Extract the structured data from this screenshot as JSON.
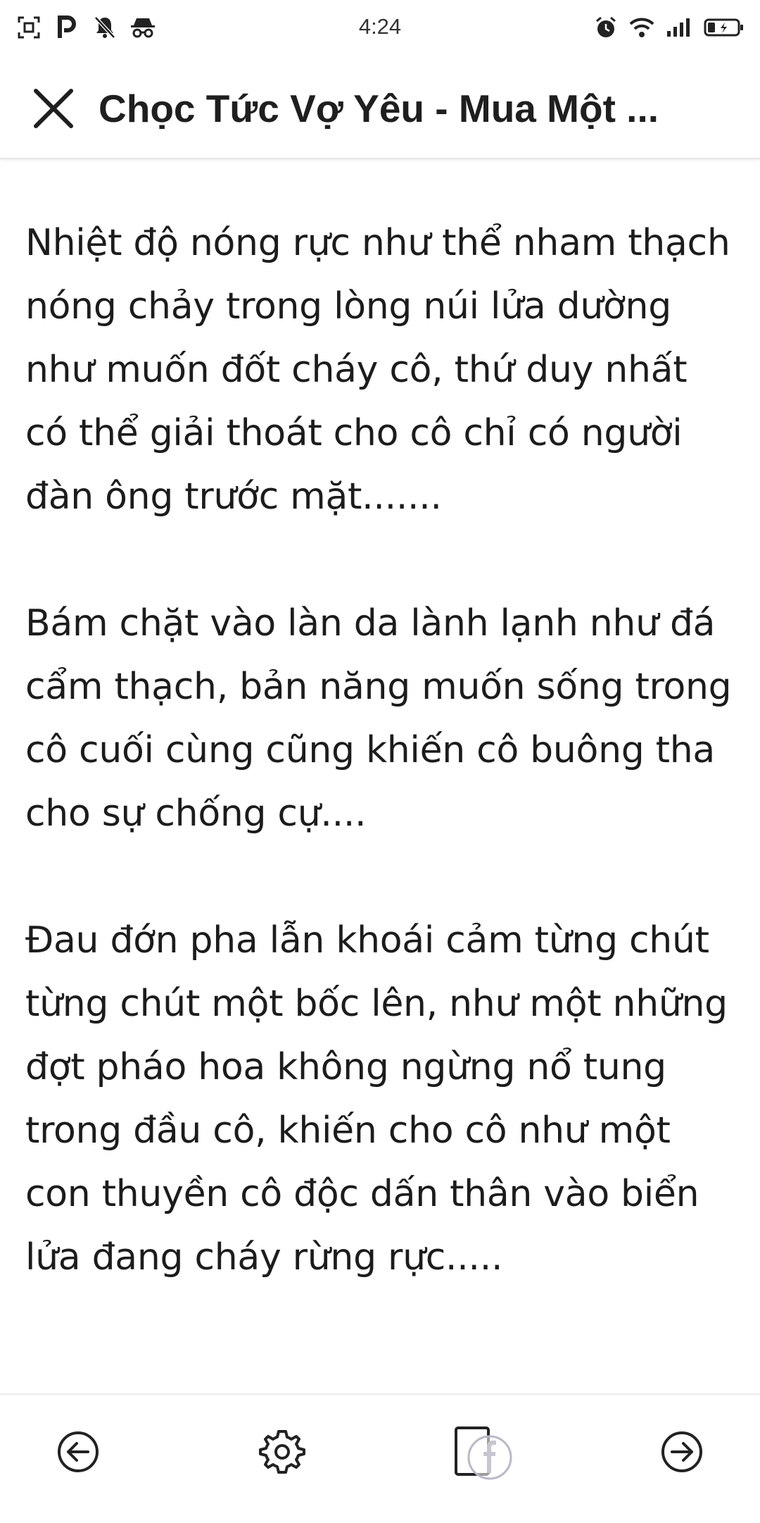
{
  "status_bar": {
    "time": "4:24",
    "left_icons": [
      "screenshot-icon",
      "parking-p-icon",
      "notifications-off-icon",
      "incognito-icon"
    ],
    "right_icons": [
      "alarm-icon",
      "wifi-icon",
      "signal-icon",
      "battery-charging-icon"
    ]
  },
  "app_bar": {
    "title": "Chọc Tức Vợ Yêu - Mua Một ...",
    "close_icon": "close-icon"
  },
  "content": {
    "paragraphs": [
      "Nhiệt độ nóng rực như thể nham thạch nóng chảy trong lòng núi lửa dường như muốn đốt cháy cô, thứ duy nhất có thể giải thoát cho cô chỉ có người đàn ông trước mặt.......",
      "Bám chặt vào làn da lành lạnh như đá cẩm thạch, bản năng muốn sống trong cô cuối cùng cũng khiến cô buông tha cho sự chống cự....",
      "Đau đớn pha lẫn khoái cảm từng chút từng chút một bốc lên, như một những đợt pháo hoa không ngừng nổ tung trong đầu cô, khiến cho cô như một con thuyền cô độc dấn thân vào biển lửa đang cháy rừng rực....."
    ]
  },
  "toolbar": {
    "prev_icon": "arrow-left-circle-icon",
    "settings_icon": "gear-icon",
    "facebook_icon": "facebook-share-icon",
    "next_icon": "arrow-right-circle-icon"
  },
  "colors": {
    "text": "#1c1c1c",
    "background": "#ffffff",
    "divider": "#e6e6e6",
    "icon": "#222222"
  }
}
